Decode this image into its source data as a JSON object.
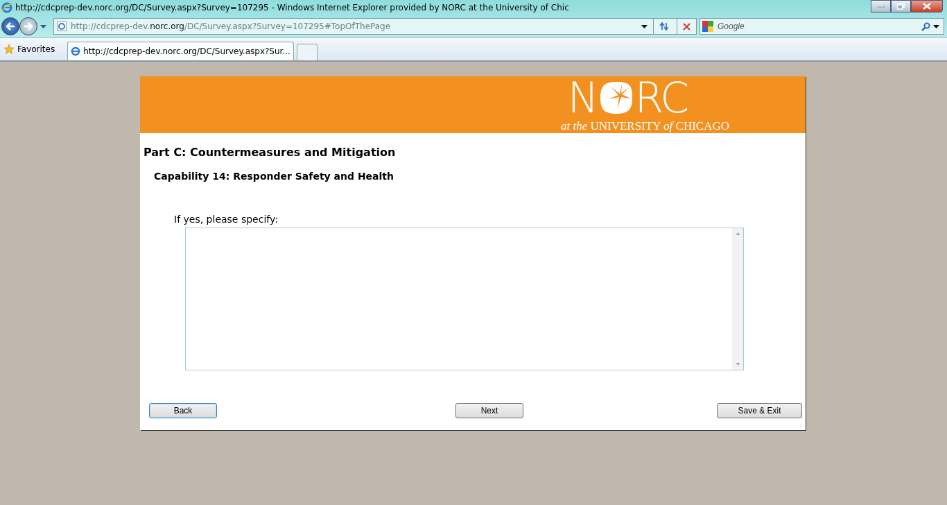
{
  "window": {
    "title": "http://cdcprep-dev.norc.org/DC/Survey.aspx?Survey=107295 - Windows Internet Explorer provided by NORC at the University of Chic"
  },
  "address_bar": {
    "url_before": "http://cdcprep-dev.",
    "url_domain": "norc.org",
    "url_after": "/DC/Survey.aspx?Survey=107295#TopOfThePage"
  },
  "search": {
    "placeholder": "Google"
  },
  "favorites": {
    "label": "Favorites"
  },
  "tabs": [
    {
      "label": "http://cdcprep-dev.norc.org/DC/Survey.aspx?Sur...",
      "selected": true
    }
  ],
  "banner": {
    "logo_left": "N",
    "logo_right": "RC",
    "tagline": "*at the* UNIVERSITY *of* CHICAGO"
  },
  "survey": {
    "part_heading": "Part C: Countermeasures and Mitigation",
    "capability_heading": "Capability 14: Responder Safety and Health",
    "question": "If yes, please specify:"
  },
  "buttons": [
    {
      "label": "Back",
      "kind": "left",
      "focused": true
    },
    {
      "label": "Next",
      "kind": "center",
      "focused": false
    },
    {
      "label": "Save & Exit",
      "kind": "right",
      "focused": false
    }
  ]
}
